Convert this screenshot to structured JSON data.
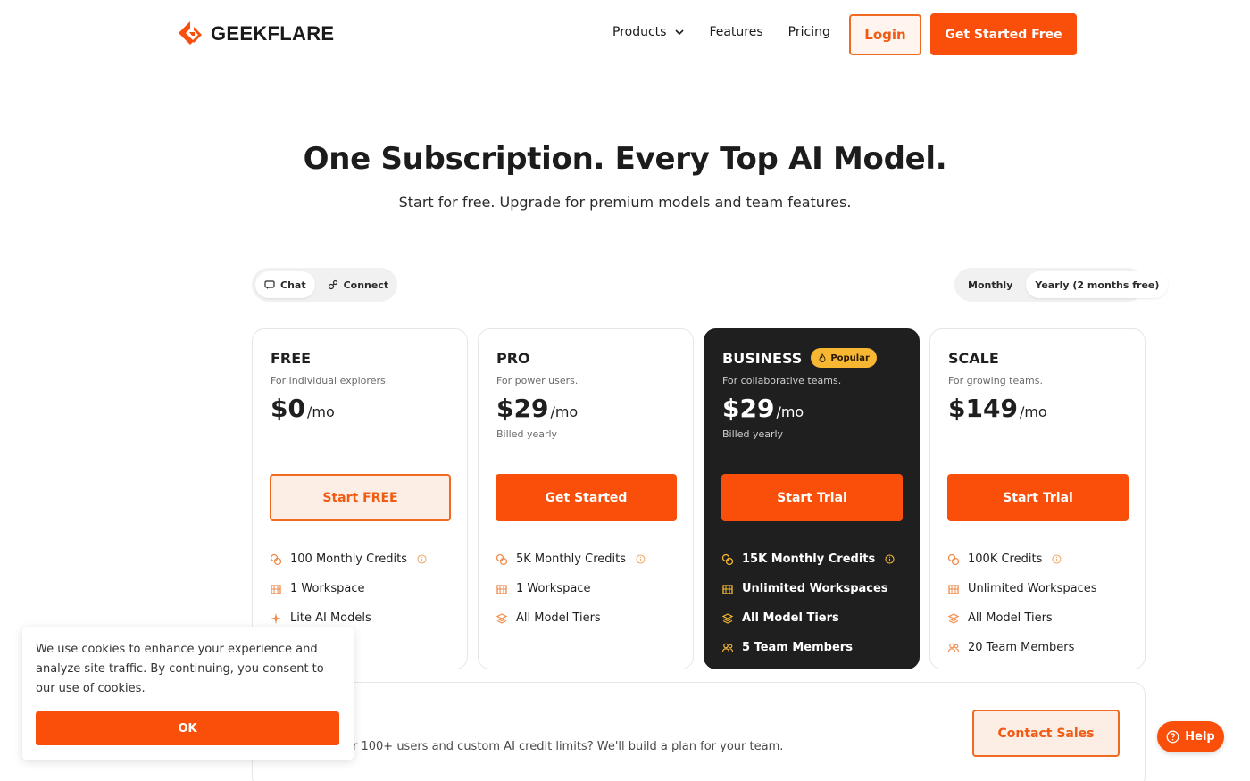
{
  "header": {
    "logo_text": "GEEKFLARE",
    "nav": [
      {
        "label": "Products",
        "has_dropdown": true
      },
      {
        "label": "Features"
      },
      {
        "label": "Pricing"
      }
    ],
    "login_label": "Login",
    "get_started_label": "Get Started Free"
  },
  "hero": {
    "title": "One Subscription. Every Top AI Model.",
    "subtitle": "Start for free. Upgrade for premium models and team features."
  },
  "mode_toggle": {
    "options": [
      {
        "label": "Chat",
        "icon": "chat-icon",
        "active": true
      },
      {
        "label": "Connect",
        "icon": "connect-icon",
        "active": false
      }
    ]
  },
  "billing_toggle": {
    "options": [
      {
        "label": "Monthly",
        "active": false
      },
      {
        "label": "Yearly (2 months free)",
        "active": true
      }
    ]
  },
  "plans": [
    {
      "name": "FREE",
      "description": "For individual explorers.",
      "price": "$0",
      "period": "/mo",
      "billed": "",
      "cta": "Start FREE",
      "features": [
        {
          "label": "100 Monthly Credits",
          "icon": "credits-icon",
          "info": true
        },
        {
          "label": "1 Workspace",
          "icon": "workspace-icon"
        },
        {
          "label": "Lite AI Models",
          "icon": "sparkle-icon"
        }
      ]
    },
    {
      "name": "PRO",
      "description": "For power users.",
      "price": "$29",
      "period": "/mo",
      "billed": "Billed yearly",
      "cta": "Get Started",
      "features": [
        {
          "label": "5K Monthly Credits",
          "icon": "credits-icon",
          "info": true
        },
        {
          "label": "1 Workspace",
          "icon": "workspace-icon"
        },
        {
          "label": "All Model Tiers",
          "icon": "layers-icon"
        }
      ]
    },
    {
      "name": "BUSINESS",
      "badge": "Popular",
      "description": "For collaborative teams.",
      "price": "$29",
      "period": "/mo",
      "billed": "Billed yearly",
      "cta": "Start Trial",
      "features": [
        {
          "label": "15K Monthly Credits",
          "icon": "credits-icon",
          "info": true
        },
        {
          "label": "Unlimited Workspaces",
          "icon": "workspace-icon"
        },
        {
          "label": "All Model Tiers",
          "icon": "layers-icon"
        },
        {
          "label": "5 Team Members",
          "icon": "team-icon"
        }
      ]
    },
    {
      "name": "SCALE",
      "description": "For growing teams.",
      "price": "$149",
      "period": "/mo",
      "billed": "",
      "cta": "Start Trial",
      "features": [
        {
          "label": "100K Credits",
          "icon": "credits-icon",
          "info": true
        },
        {
          "label": "Unlimited Workspaces",
          "icon": "workspace-icon"
        },
        {
          "label": "All Model Tiers",
          "icon": "layers-icon"
        },
        {
          "label": "20 Team Members",
          "icon": "team-icon"
        }
      ]
    }
  ],
  "enterprise": {
    "text": "r 100+ users and custom AI credit limits? We'll build a plan for your team.",
    "contact_label": "Contact Sales"
  },
  "cookie": {
    "text": "We use cookies to enhance your experience and analyze site traffic. By continuing, you consent to our use of cookies.",
    "ok_label": "OK"
  },
  "help": {
    "label": "Help"
  },
  "colors": {
    "accent": "#fa4f0a",
    "dark_card": "#1f1f1f",
    "badge": "#f7b733"
  }
}
